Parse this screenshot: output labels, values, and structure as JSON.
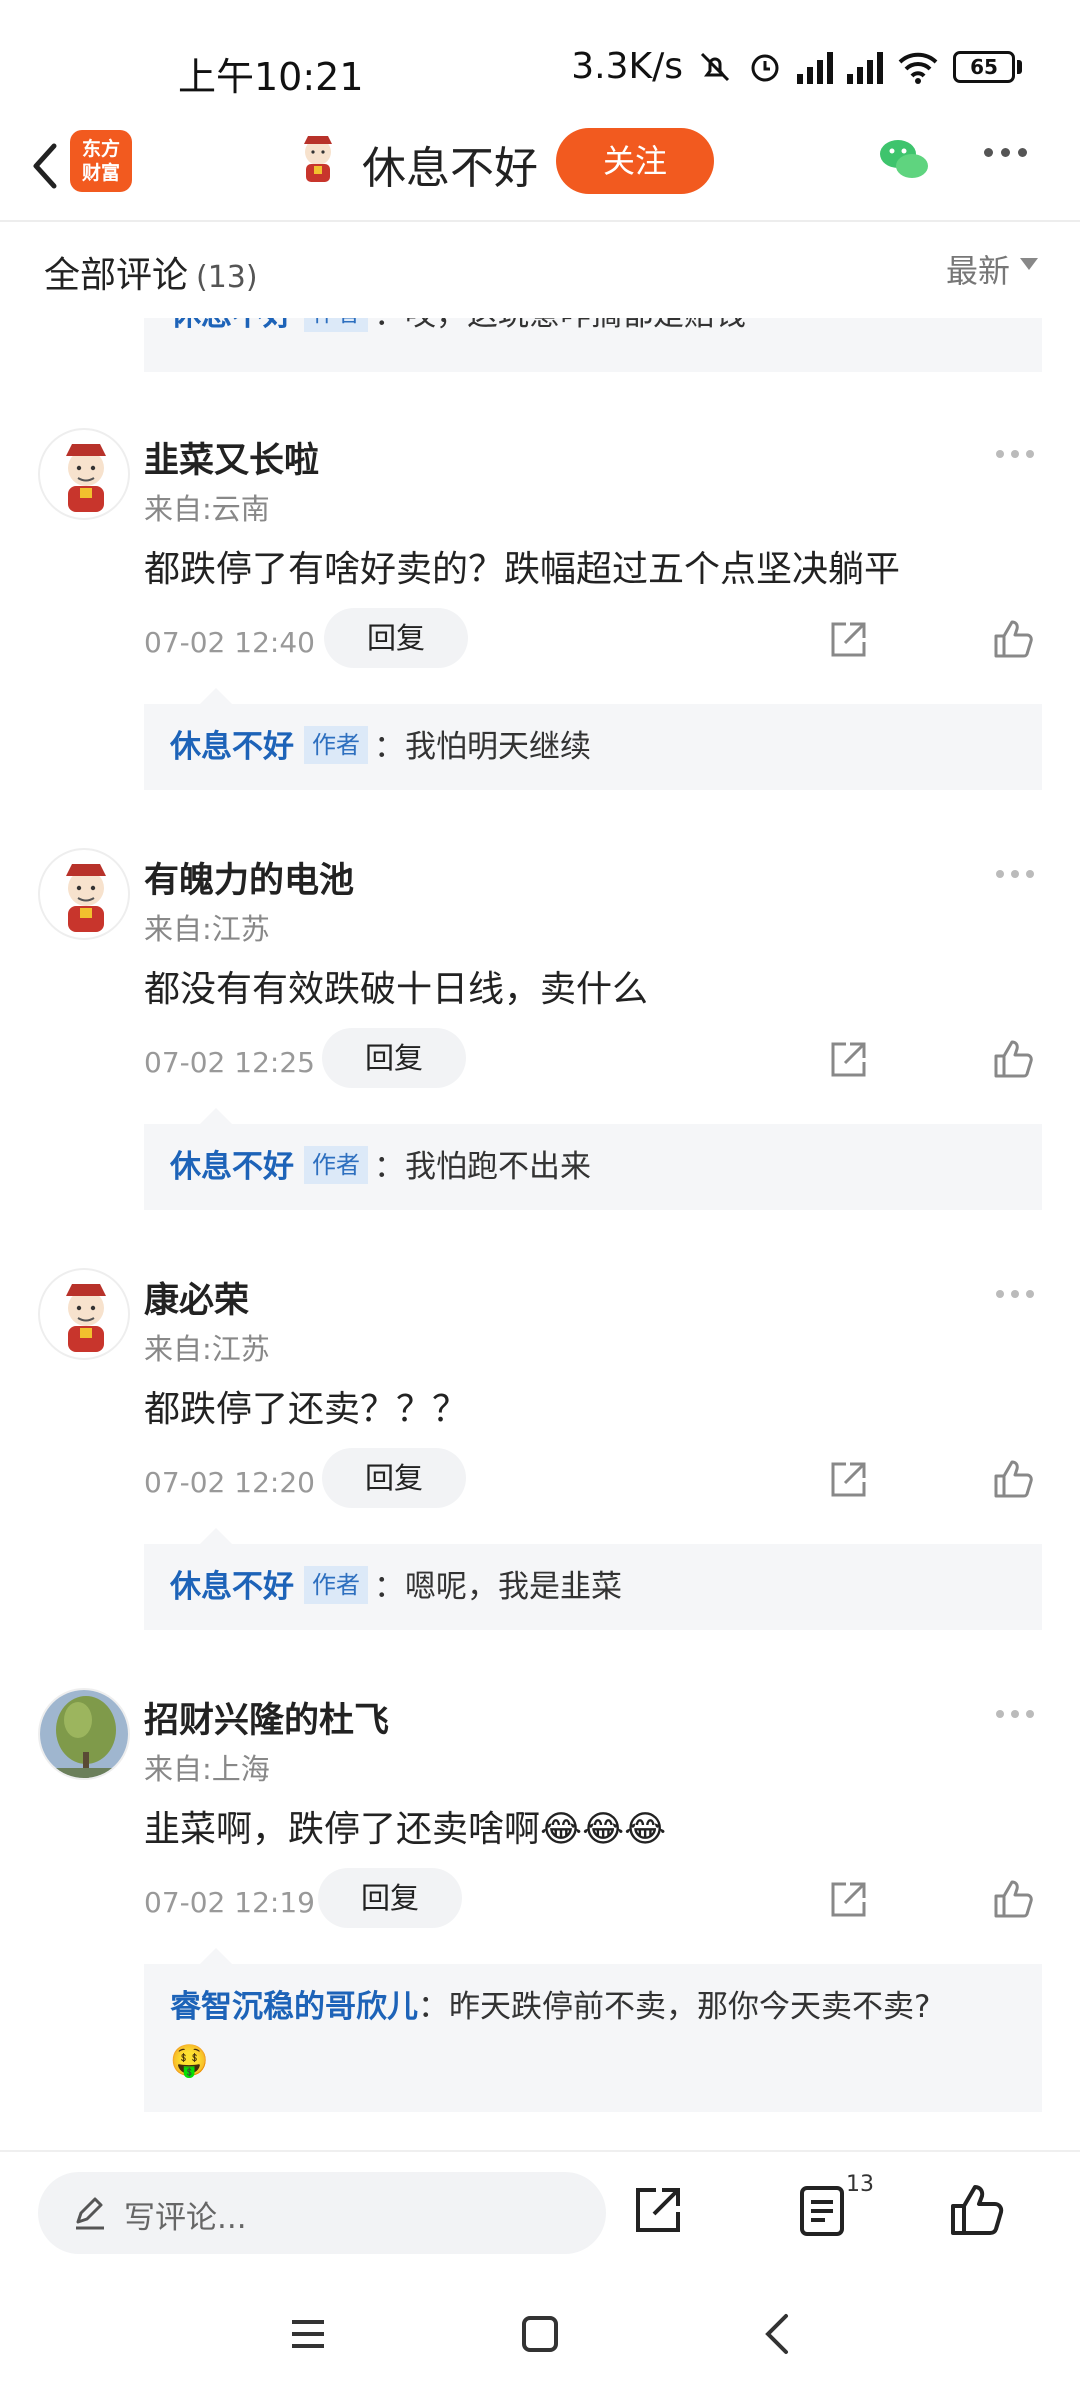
{
  "status_bar": {
    "time": "上午10:21",
    "network_speed": "3.3K/s",
    "battery": "65"
  },
  "header": {
    "app_logo": "东方\n财富",
    "username": "休息不好",
    "follow_label": "关注"
  },
  "tabs": {
    "title": "全部评论",
    "count": "(13)",
    "sort": "最新"
  },
  "top_partial_reply": {
    "name": "休息不好",
    "tag": "作者",
    "text": "：哎，这玩意咋搞都是赔钱"
  },
  "comments": [
    {
      "name": "韭菜又长啦",
      "location": "来自:云南",
      "text": "都跌停了有啥好卖的？跌幅超过五个点坚决躺平",
      "date": "07-02 12:40",
      "reply_label": "回复",
      "reply": {
        "name": "休息不好",
        "tag": "作者",
        "text": "：我怕明天继续"
      }
    },
    {
      "name": "有魄力的电池",
      "location": "来自:江苏",
      "text": "都没有有效跌破十日线，卖什么",
      "date": "07-02 12:25",
      "reply_label": "回复",
      "reply": {
        "name": "休息不好",
        "tag": "作者",
        "text": "：我怕跑不出来"
      }
    },
    {
      "name": "康必荣",
      "location": "来自:江苏",
      "text": "都跌停了还卖？？？",
      "date": "07-02 12:20",
      "reply_label": "回复",
      "reply": {
        "name": "休息不好",
        "tag": "作者",
        "text": "：嗯呢，我是韭菜"
      }
    },
    {
      "name": "招财兴隆的杜飞",
      "location": "来自:上海",
      "text": "韭菜啊，跌停了还卖啥啊😂😂😂",
      "date": "07-02 12:19",
      "reply_label": "回复",
      "reply": {
        "name": "睿智沉稳的哥欣儿",
        "tag": "",
        "text": "：昨天跌停前不卖，那你今天卖不卖?",
        "emoji": "🤑"
      }
    }
  ],
  "bottom_bar": {
    "placeholder": "写评论...",
    "comment_count": "13"
  },
  "colors": {
    "brand": "#f25a1f",
    "link_blue": "#1d63b8"
  }
}
